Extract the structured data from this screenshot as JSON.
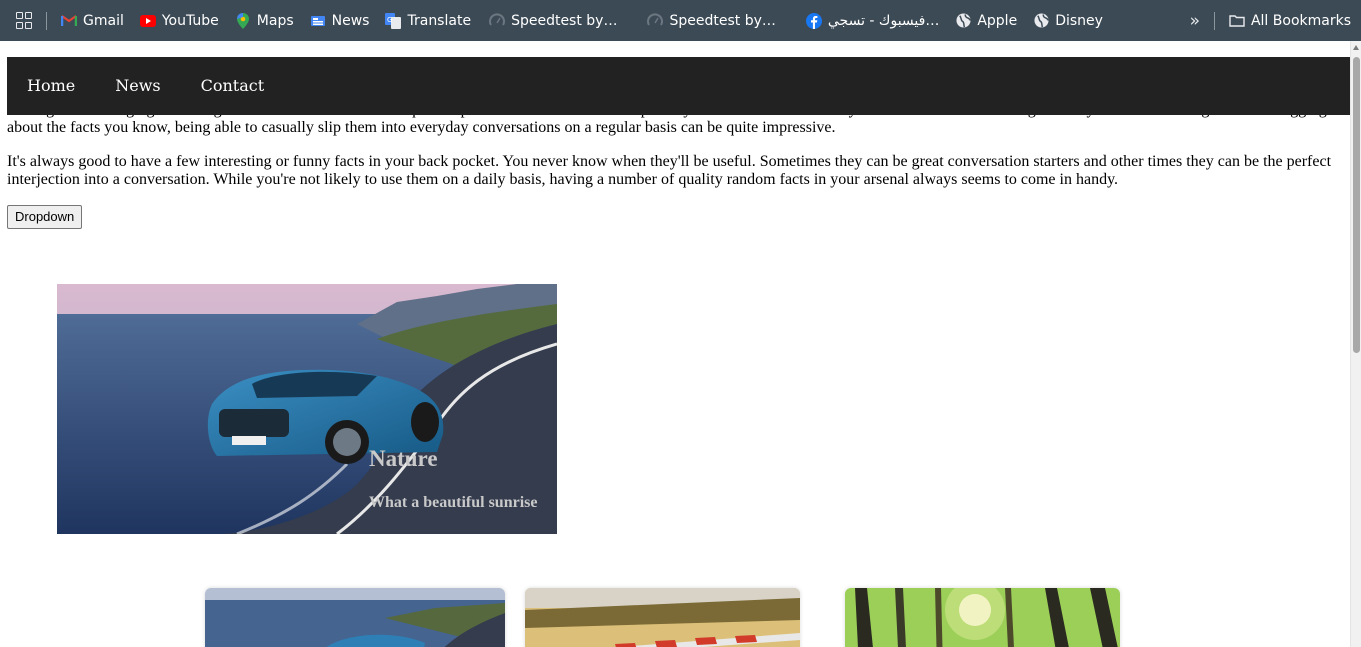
{
  "bookmarks": {
    "items": [
      {
        "label": "Gmail",
        "icon": "gmail-icon"
      },
      {
        "label": "YouTube",
        "icon": "youtube-icon"
      },
      {
        "label": "Maps",
        "icon": "maps-icon"
      },
      {
        "label": "News",
        "icon": "news-icon"
      },
      {
        "label": "Translate",
        "icon": "translate-icon"
      },
      {
        "label": "Speedtest by…",
        "icon": "speedtest-icon"
      },
      {
        "label": "Speedtest by…",
        "icon": "speedtest-icon"
      },
      {
        "label": "فيسبوك - تسجي…",
        "icon": "facebook-icon"
      },
      {
        "label": "Apple",
        "icon": "globe-icon"
      },
      {
        "label": "Disney",
        "icon": "globe-icon"
      }
    ],
    "overflow": "»",
    "all_bookmarks": "All Bookmarks"
  },
  "nav": {
    "links": [
      "Home",
      "News",
      "Contact"
    ]
  },
  "content": {
    "paragraph1": "Having a wide-ranging knowledge of random fun facts can be quite impressive to others. This is especially true if the random facts you memorize are interesting. While you don't want to go around bragging about the facts you know, being able to casually slip them into everyday conversations on a regular basis can be quite impressive.",
    "paragraph2": "It's always good to have a few interesting or funny facts in your back pocket. You never know when they'll be useful. Sometimes they can be great conversation starters and other times they can be the perfect interjection into a conversation. While you're not likely to use them on a daily basis, having a number of quality random facts in your arsenal always seems to come in handy.",
    "dropdown_label": "Dropdown"
  },
  "hero": {
    "title": "Nature",
    "caption": "What a beautiful sunrise"
  },
  "colors": {
    "bookmarks_bar": "#3c4a55",
    "navbar": "#222222",
    "nav_text": "#ffffff",
    "hero_text": "#c9c9c9"
  }
}
